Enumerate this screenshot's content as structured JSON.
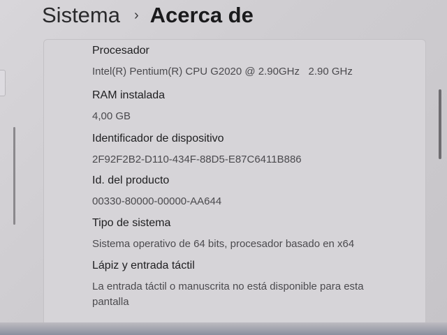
{
  "breadcrumb": {
    "root": "Sistema",
    "separator": "›",
    "current": "Acerca de"
  },
  "specs": [
    {
      "label": "Procesador",
      "value": "Intel(R) Pentium(R) CPU G2020 @ 2.90GHz   2.90 GHz"
    },
    {
      "label": "RAM instalada",
      "value": "4,00 GB"
    },
    {
      "label": "Identificador de dispositivo",
      "value": "2F92F2B2-D110-434F-88D5-E87C6411B886"
    },
    {
      "label": "Id. del producto",
      "value": "00330-80000-00000-AA644"
    },
    {
      "label": "Tipo de sistema",
      "value": "Sistema operativo de 64 bits, procesador basado en x64"
    },
    {
      "label": "Lápiz y entrada táctil",
      "value": "La entrada táctil o manuscrita no está disponible para esta pantalla"
    }
  ]
}
